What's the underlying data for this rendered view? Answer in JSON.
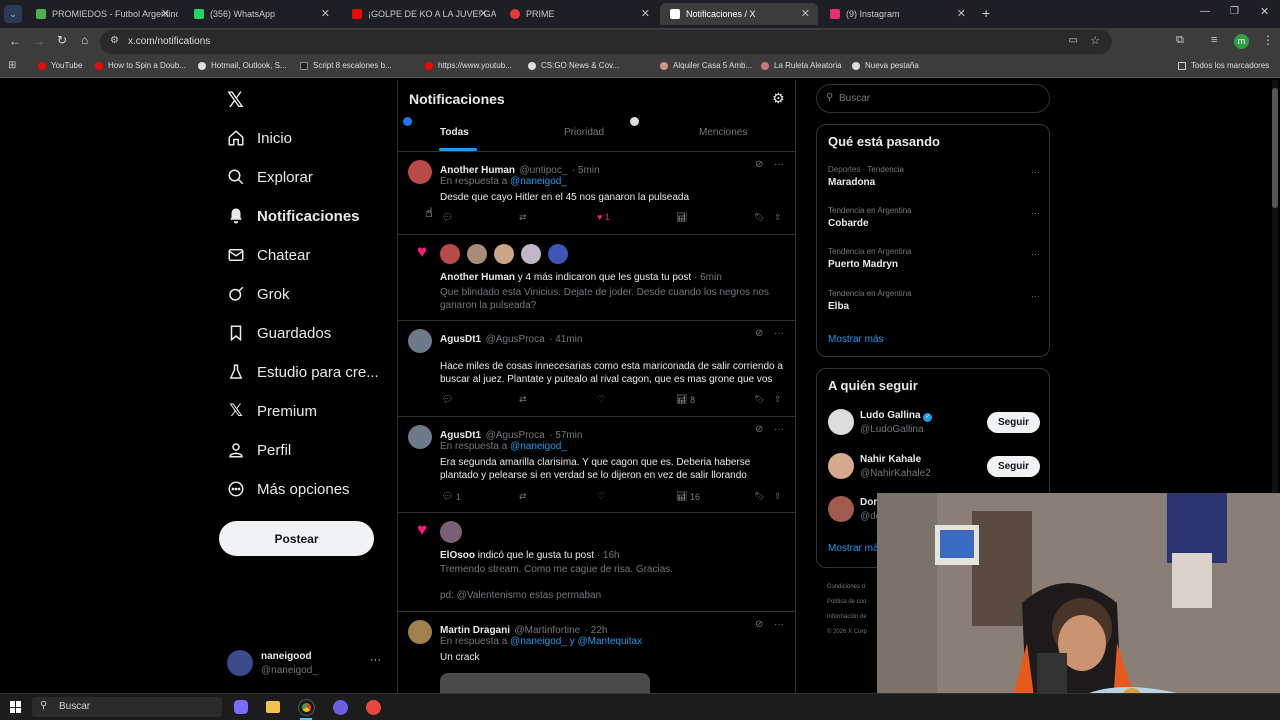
{
  "browser": {
    "tabs": [
      {
        "title": "PROMIEDOS - Futbol Argentino",
        "color": "#4caf50"
      },
      {
        "title": "(356) WhatsApp",
        "color": "#25d366"
      },
      {
        "title": "¡GOLPE DE KO A LA JUVE! GALA",
        "color": "#ff0000"
      },
      {
        "title": "PRIME",
        "color": "#e53935"
      },
      {
        "title": "Notificaciones / X",
        "color": "#ffffff"
      },
      {
        "title": "(9) Instagram",
        "color": "#e1306c"
      }
    ],
    "url": "x.com/notifications",
    "bookmarks": [
      "YouTube",
      "How to Spin a Doub...",
      "Hotmail, Outlook, S...",
      "Script 8 escalones b...",
      "https://www.youtub...",
      "CS:GO News & Cov...",
      "Alquiler Casa 5 Amb...",
      "La Ruleta Aleatoria",
      "Nueva pestaña"
    ],
    "all_bookmarks": "Todos los marcadores",
    "profile_initial": "m"
  },
  "nav": {
    "items": [
      "Inicio",
      "Explorar",
      "Notificaciones",
      "Chatear",
      "Grok",
      "Guardados",
      "Estudio para cre...",
      "Premium",
      "Perfil",
      "Más opciones"
    ],
    "post": "Postear",
    "account_name": "naneigood",
    "account_handle": "@naneigod_"
  },
  "header": {
    "title": "Notificaciones",
    "tabs": [
      "Todas",
      "Prioridad",
      "Menciones"
    ]
  },
  "notifications": [
    {
      "name": "Another Human",
      "handle": "@untipoc_",
      "time": "· 5min",
      "reply_prefix": "En respuesta a",
      "reply_to": "@naneigod_",
      "text": "Desde que cayo Hitler en el 45 nos ganaron la pulseada",
      "likes": "1"
    },
    {
      "name": "Another Human",
      "action": "y 4 más indicaron que les gusta tu post",
      "time": "· 6min",
      "quote": "Que blindado esta Vinicius. Dejate de joder. Desde cuando los negros nos ganaron la pulseada?"
    },
    {
      "name": "AgusDt1",
      "handle": "@AgusProca",
      "time": "· 41min",
      "text": "Hace miles de cosas innecesarias como esta mariconada de salir corriendo a buscar al juez. Plantate y putealo al rival cagon, que es mas grone que vos",
      "views": "8"
    },
    {
      "name": "AgusDt1",
      "handle": "@AgusProca",
      "time": "· 57min",
      "reply_prefix": "En respuesta a",
      "reply_to": "@naneigod_",
      "text": "Era segunda amarilla clarisima. Y que cagon que es. Deberia haberse plantado y pelearse si en verdad se lo dijeron en vez de salir llorando",
      "replies": "1",
      "views": "16"
    },
    {
      "name": "ElOsoo",
      "action": "indicó que le gusta tu post",
      "time": "· 16h",
      "quote": "Tremendo stream. Como me cague de risa. Gracias.",
      "quote2": "pd: @Valentenismo estas permaban"
    },
    {
      "name": "Martin Dragani",
      "handle": "@Martinfortine",
      "time": "· 22h",
      "reply_prefix": "En respuesta a",
      "reply_to": "@naneigod_ y @Mantequitax",
      "text": "Un crack"
    }
  ],
  "right": {
    "search_placeholder": "Buscar",
    "trends_title": "Qué está pasando",
    "trends": [
      {
        "context": "Deportes · Tendencia",
        "name": "Maradona"
      },
      {
        "context": "Tendencia en Argentina",
        "name": "Cobarde"
      },
      {
        "context": "Tendencia en Argentina",
        "name": "Puerto Madryn"
      },
      {
        "context": "Tendencia en Argentina",
        "name": "Elba"
      }
    ],
    "show_more": "Mostrar más",
    "follow_title": "A quién seguir",
    "follow": [
      {
        "name": "Ludo Gallina",
        "handle": "@LudoGallina",
        "verified": true
      },
      {
        "name": "Nahir Kahale",
        "handle": "@NahirKahale2"
      },
      {
        "name": "Dor",
        "handle": "@dc"
      }
    ],
    "follow_label": "Seguir",
    "footer": [
      "Condiciones d",
      "Política de coo",
      "Información de",
      "© 2026 X Corp"
    ]
  },
  "taskbar": {
    "search": "Buscar"
  }
}
